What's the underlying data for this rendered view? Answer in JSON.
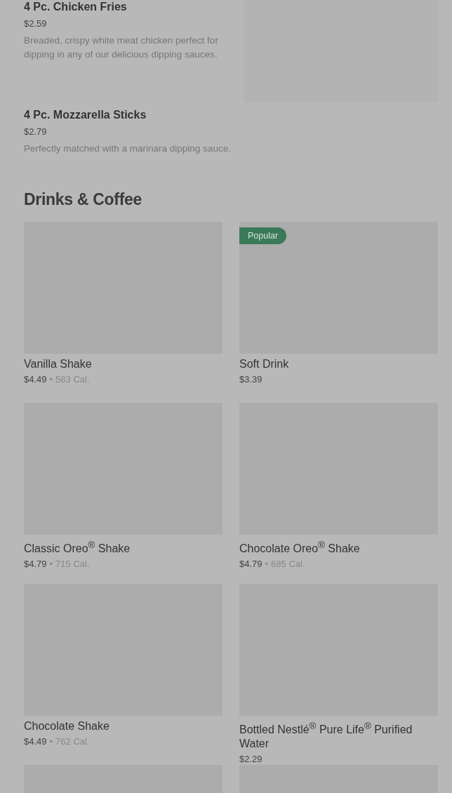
{
  "sides": [
    {
      "name": "4 Pc. Chicken Fries",
      "price": "$2.59",
      "description": "Breaded, crispy white meat chicken perfect for dipping in any of our delicious dipping sauces."
    },
    {
      "name": "4 Pc. Mozzarella Sticks",
      "price": "$2.79",
      "description": "Perfectly matched with a marinara dipping sauce."
    }
  ],
  "section": {
    "title": "Drinks & Coffee",
    "rows": [
      {
        "items": [
          {
            "name": "Vanilla Shake",
            "price": "$4.49",
            "separator": "•",
            "calories": "583 Cal."
          },
          {
            "badge": "Popular",
            "name": "Soft Drink",
            "price": "$3.39"
          }
        ]
      },
      {
        "items": [
          {
            "name": "Classic Oreo$^{®}$ Shake",
            "price": "$4.79",
            "separator": "•",
            "calories": "715 Cal."
          },
          {
            "name": "Chocolate Oreo$^{®}$ Shake",
            "price": "$4.79",
            "separator": "•",
            "calories": "685 Cal."
          }
        ]
      },
      {
        "items": [
          {
            "name": "Chocolate Shake",
            "price": "$4.49",
            "separator": "•",
            "calories": "762 Cal."
          },
          {
            "name": "Bottled Nestlé$^{®}$ Pure Life$^{®}$ Purified Water",
            "price": "$2.29"
          }
        ]
      }
    ]
  }
}
